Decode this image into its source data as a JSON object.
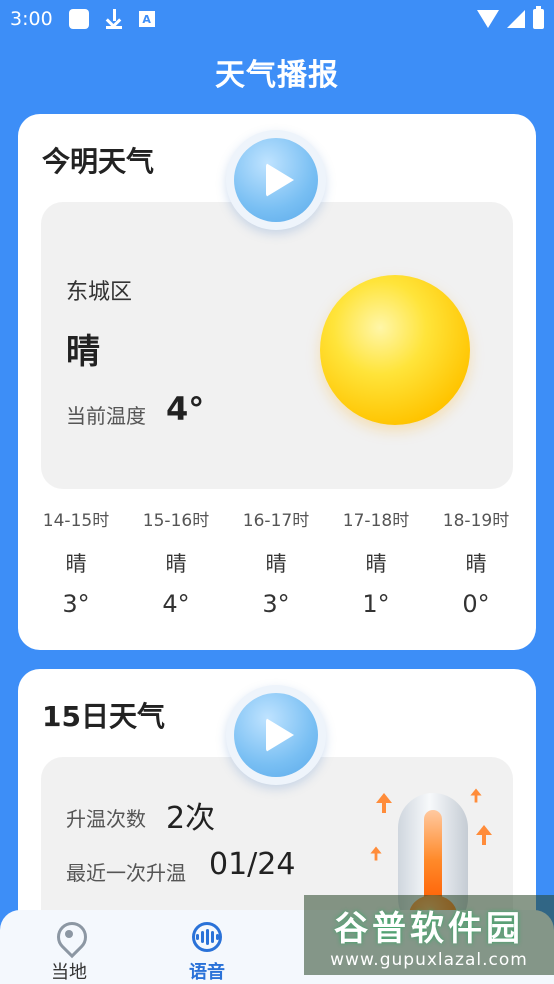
{
  "status_bar": {
    "time": "3:00"
  },
  "header": {
    "title": "天气播报"
  },
  "today_card": {
    "title": "今明天气",
    "district": "东城区",
    "condition": "晴",
    "temp_label": "当前温度",
    "temp_value": "4°",
    "hourly": [
      {
        "time": "14-15时",
        "cond": "晴",
        "temp": "3°"
      },
      {
        "time": "15-16时",
        "cond": "晴",
        "temp": "4°"
      },
      {
        "time": "16-17时",
        "cond": "晴",
        "temp": "3°"
      },
      {
        "time": "17-18时",
        "cond": "晴",
        "temp": "1°"
      },
      {
        "time": "18-19时",
        "cond": "晴",
        "temp": "0°"
      }
    ]
  },
  "forecast_card": {
    "title": "15日天气",
    "warm_count_label": "升温次数",
    "warm_count_value": "2次",
    "last_warm_label": "最近一次升温",
    "last_warm_value": "01/24"
  },
  "bottom_nav": {
    "items": [
      {
        "label": "当地",
        "icon": "location-pin-icon"
      },
      {
        "label": "语音",
        "icon": "voice-wave-icon",
        "active": true
      }
    ]
  },
  "watermark": {
    "title": "谷普软件园",
    "url": "www.gupuxlazal.com"
  },
  "colors": {
    "background": "#3d8ef7",
    "accent": "#2a72d8",
    "card": "#ffffff"
  }
}
